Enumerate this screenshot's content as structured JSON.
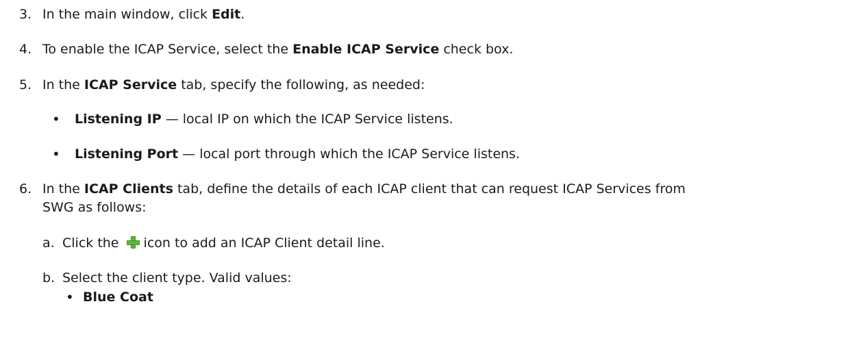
{
  "steps": {
    "s3": {
      "num": "3.",
      "pre": "In the main window, click ",
      "bold": "Edit",
      "post": "."
    },
    "s4": {
      "num": "4.",
      "pre": "To enable the ICAP Service, select the ",
      "bold": "Enable ICAP Service",
      "post": " check box."
    },
    "s5": {
      "num": "5.",
      "pre": "In the ",
      "bold": "ICAP Service",
      "post": " tab, specify the following, as needed:"
    },
    "s5_b1": {
      "bullet": "•",
      "bold": "Listening IP",
      "post": " — local IP on which the ICAP Service listens."
    },
    "s5_b2": {
      "bullet": "•",
      "bold": "Listening Port",
      "post": " — local port through which the ICAP Service listens."
    },
    "s6": {
      "num": "6.",
      "pre": "In the ",
      "bold": "ICAP Clients",
      "post": " tab, define the details of each ICAP client that can request ICAP Services from",
      "cont": "SWG as follows:"
    },
    "s6a": {
      "num": "a.",
      "pre": "Click the ",
      "post": "icon to add an ICAP Client detail line.",
      "icon": "plus-icon"
    },
    "s6b": {
      "num": "b.",
      "text": "Select the client type. Valid values:"
    },
    "s6b_b1": {
      "bullet": "•",
      "bold": "Blue Coat"
    }
  }
}
